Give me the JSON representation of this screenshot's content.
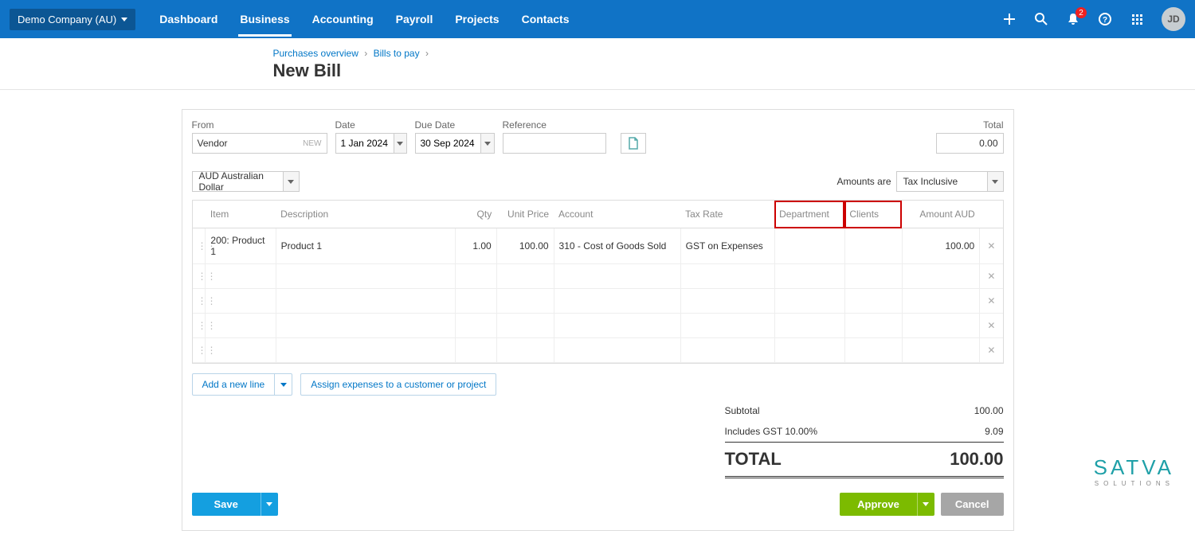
{
  "header": {
    "org": "Demo Company (AU)",
    "nav": [
      "Dashboard",
      "Business",
      "Accounting",
      "Payroll",
      "Projects",
      "Contacts"
    ],
    "notification_count": "2",
    "avatar": "JD"
  },
  "breadcrumb": {
    "items": [
      "Purchases overview",
      "Bills to pay"
    ],
    "title": "New Bill"
  },
  "form": {
    "labels": {
      "from": "From",
      "date": "Date",
      "due": "Due Date",
      "reference": "Reference",
      "total": "Total",
      "amounts_are": "Amounts are"
    },
    "from_value": "Vendor",
    "from_badge": "NEW",
    "date_value": "1 Jan 2024",
    "due_value": "30 Sep 2024",
    "reference_value": "",
    "total_value": "0.00",
    "currency": "AUD Australian Dollar",
    "amounts_are_value": "Tax Inclusive"
  },
  "columns": {
    "item": "Item",
    "description": "Description",
    "qty": "Qty",
    "unit_price": "Unit Price",
    "account": "Account",
    "tax_rate": "Tax Rate",
    "department": "Department",
    "clients": "Clients",
    "amount": "Amount AUD"
  },
  "rows": [
    {
      "item": "200: Product 1",
      "description": "Product 1",
      "qty": "1.00",
      "unit_price": "100.00",
      "account": "310 - Cost of Goods Sold",
      "tax_rate": "GST on Expenses",
      "department": "",
      "clients": "",
      "amount": "100.00"
    },
    {},
    {},
    {},
    {}
  ],
  "actions": {
    "add_line": "Add a new line",
    "assign": "Assign expenses to a customer or project"
  },
  "totals": {
    "subtotal_label": "Subtotal",
    "subtotal_value": "100.00",
    "gst_label": "Includes GST 10.00%",
    "gst_value": "9.09",
    "total_label": "TOTAL",
    "total_value": "100.00"
  },
  "buttons": {
    "save": "Save",
    "approve": "Approve",
    "cancel": "Cancel"
  },
  "logo": {
    "name": "SATVA",
    "sub": "SOLUTIONS"
  }
}
